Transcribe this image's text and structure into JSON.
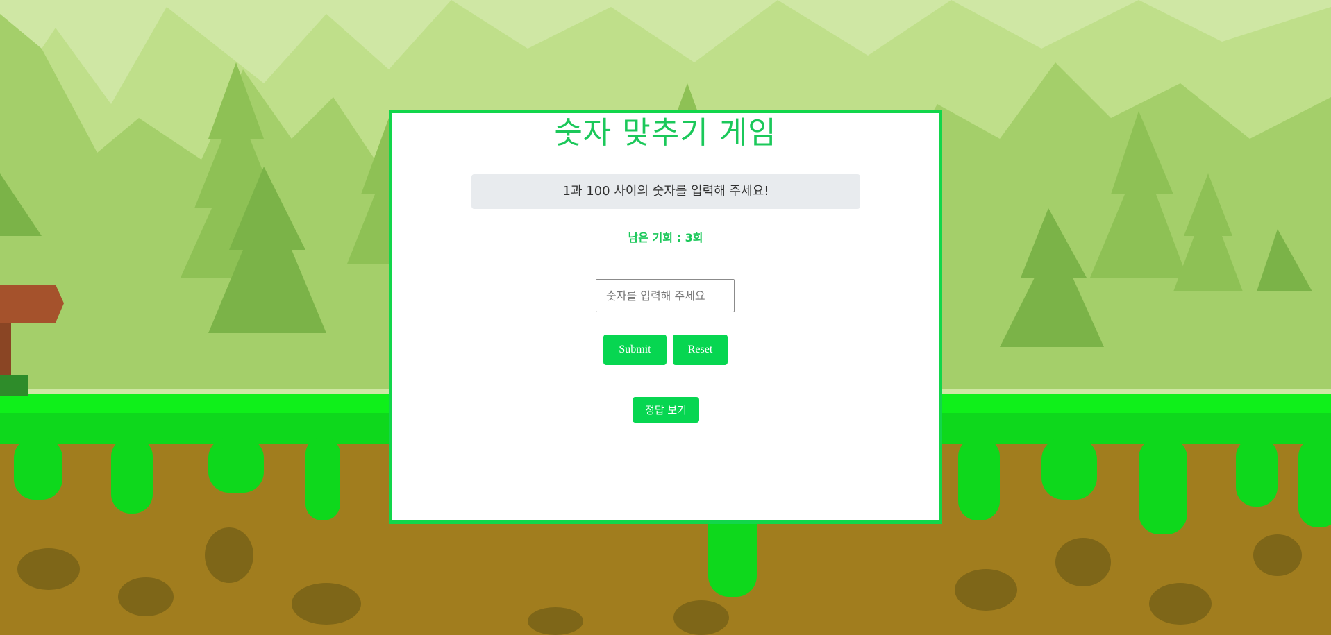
{
  "game": {
    "title": "숫자 맞추기 게임",
    "message": "1과 100 사이의 숫자를 입력해 주세요!",
    "chances_text": "남은 기회 : 3회",
    "remaining_chances": 3,
    "input": {
      "value": "",
      "placeholder": "숫자를 입력해 주세요"
    },
    "buttons": {
      "submit": "Submit",
      "reset": "Reset",
      "show_answer": "정답 보기"
    }
  },
  "colors": {
    "accent": "#12d64b",
    "button": "#07d651",
    "message_bg": "#e8ebee"
  }
}
